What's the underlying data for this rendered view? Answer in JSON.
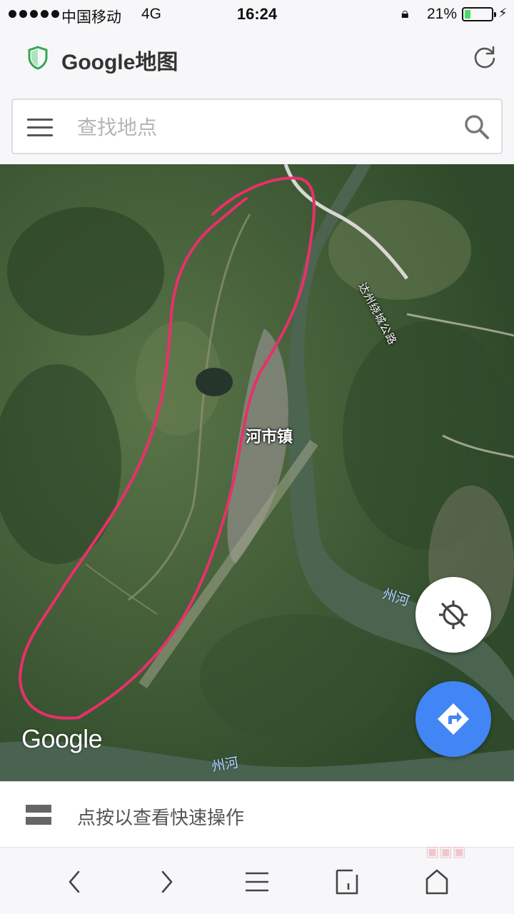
{
  "status_bar": {
    "carrier": "中国移动",
    "network": "4G",
    "time": "16:24",
    "battery_percent": "21%",
    "battery_level": 0.21,
    "icons": [
      "signal-dots-icon",
      "orientation-lock-icon",
      "battery-icon",
      "charging-icon"
    ]
  },
  "header": {
    "title": "Google地图",
    "icons": [
      "shield-icon",
      "reload-icon"
    ],
    "accent_color": "#34a853"
  },
  "search": {
    "placeholder": "查找地点",
    "icons": [
      "menu-icon",
      "search-icon"
    ]
  },
  "map": {
    "town_label": "河市镇",
    "road_label": "达州绕城公路",
    "river_label_1": "州河",
    "river_label_2": "州河",
    "logo": "Google",
    "annotation_color": "#e8306a",
    "locate_icon": "location-off-icon",
    "directions_icon": "directions-icon",
    "directions_color": "#4285f4"
  },
  "quick_actions": {
    "text": "点按以查看快速操作",
    "icon": "layers-icon"
  },
  "bottom_nav": {
    "icons": [
      "back-icon",
      "forward-icon",
      "menu-lines-icon",
      "tabs-icon",
      "home-icon"
    ]
  },
  "watermark": "图客网"
}
